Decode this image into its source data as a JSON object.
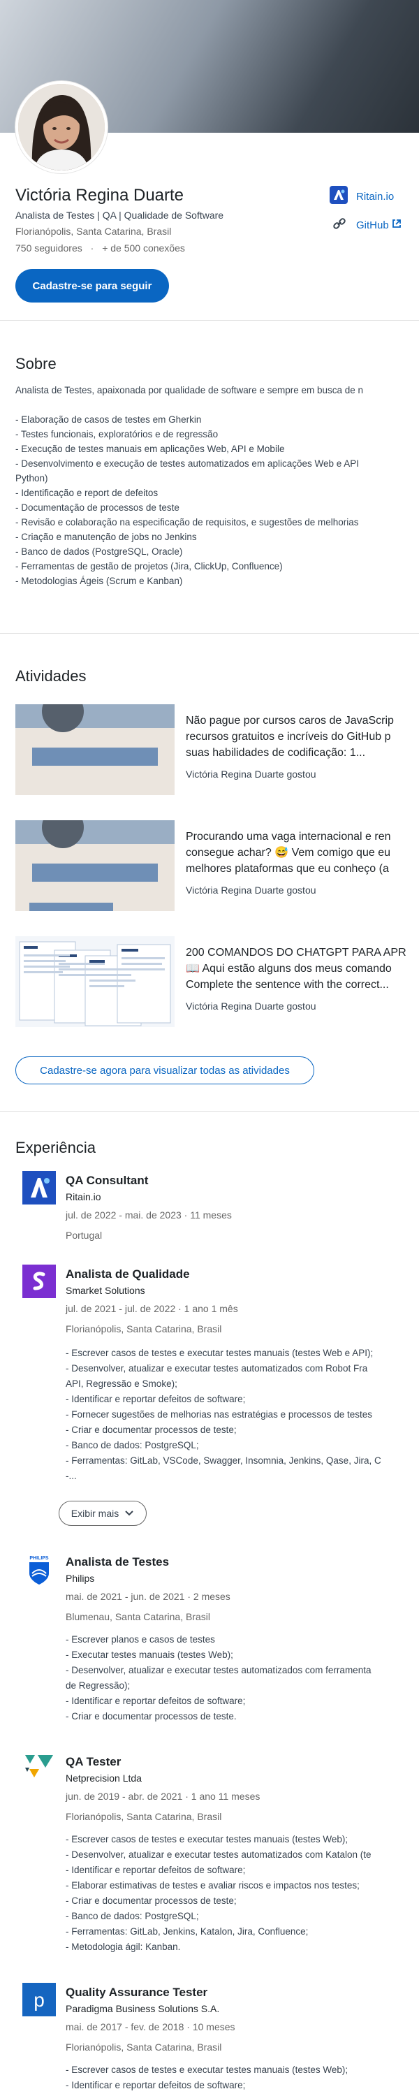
{
  "profile": {
    "name": "Victória Regina Duarte",
    "headline": "Analista de Testes | QA | Qualidade de Software",
    "location": "Florianópolis, Santa Catarina, Brasil",
    "followers": "750 seguidores",
    "separator": "·",
    "connections": "+ de 500 conexões",
    "follow_button": "Cadastre-se para seguir",
    "links": [
      {
        "label": "Ritain.io",
        "icon": "ritain-logo-icon"
      },
      {
        "label": "GitHub",
        "icon": "link-icon",
        "external_icon": "external-link-icon"
      }
    ]
  },
  "about": {
    "title": "Sobre",
    "text": "Analista de Testes, apaixonada por qualidade de software e sempre em busca de n\n\n- Elaboração de casos de testes em Gherkin\n- Testes funcionais, exploratórios e de regressão\n- Execução de testes manuais em aplicações Web, API e Mobile\n- Desenvolvimento e execução de testes automatizados em aplicações Web e API\nPython)\n- Identificação e report de defeitos\n- Documentação de processos de teste\n- Revisão e colaboração na especificação de requisitos, e sugestões de melhorias\n- Criação e manutenção de jobs no Jenkins\n- Banco de dados (PostgreSQL, Oracle)\n- Ferramentas de gestão de projetos (Jira, ClickUp, Confluence)\n- Metodologias Ágeis (Scrum e Kanban)"
  },
  "activities": {
    "title": "Atividades",
    "items": [
      {
        "title": "Não pague por cursos caros de JavaScrip\nrecursos gratuitos e incríveis do GitHub p\nsuas habilidades de codificação: 1...",
        "liked": "Victória Regina Duarte gostou"
      },
      {
        "title": "Procurando uma vaga internacional e ren\nconsegue achar? 😅 Vem comigo que eu\nmelhores plataformas que eu conheço (a",
        "liked": "Victória Regina Duarte gostou"
      },
      {
        "title": "200 COMANDOS DO CHATGPT PARA APR\n📖 Aqui estão alguns dos meus comando\nComplete the sentence with the correct...",
        "liked": "Victória Regina Duarte gostou"
      }
    ],
    "button": "Cadastre-se agora para visualizar todas as atividades"
  },
  "experience": {
    "title": "Experiência",
    "show_more": "Exibir mais",
    "items": [
      {
        "role": "QA Consultant",
        "company": "Ritain.io",
        "dates": "jul. de 2022 - mai. de 2023 · 11 meses",
        "location": "Portugal",
        "description": "",
        "color": "#1e4fbf"
      },
      {
        "role": "Analista de Qualidade",
        "company": "Smarket Solutions",
        "dates": "jul. de 2021 - jul. de 2022 · 1 ano 1 mês",
        "location": "Florianópolis, Santa Catarina, Brasil",
        "description": "- Escrever casos de testes e executar testes manuais (testes Web e API);\n- Desenvolver, atualizar e executar testes automatizados com Robot Fra\nAPI, Regressão e Smoke);\n- Identificar e reportar defeitos de software;\n- Fornecer sugestões de melhorias nas estratégias e processos de testes\n- Criar e documentar processos de teste;\n- Banco de dados: PostgreSQL;\n- Ferramentas: GitLab, VSCode, Swagger, Insomnia, Jenkins, Qase, Jira, C\n-...",
        "color": "#7b2fd1"
      },
      {
        "role": "Analista de Testes",
        "company": "Philips",
        "dates": "mai. de 2021 - jun. de 2021 · 2 meses",
        "location": "Blumenau, Santa Catarina, Brasil",
        "description": "- Escrever planos e casos de testes\n- Executar testes manuais (testes Web);\n- Desenvolver, atualizar e executar testes automatizados com ferramenta\nde Regressão);\n- Identificar e reportar defeitos de software;\n- Criar e documentar processos de teste.",
        "color": "#0b5ed7"
      },
      {
        "role": "QA Tester",
        "company": "Netprecision Ltda",
        "dates": "jun. de 2019 - abr. de 2021 · 1 ano 11 meses",
        "location": "Florianópolis, Santa Catarina, Brasil",
        "description": "- Escrever casos de testes e executar testes manuais (testes Web);\n- Desenvolver, atualizar e executar testes automatizados com Katalon (te\n- Identificar e reportar defeitos de software;\n- Elaborar estimativas de testes e avaliar riscos e impactos nos testes;\n- Criar e documentar processos de teste;\n- Banco de dados: PostgreSQL;\n- Ferramentas: GitLab, Jenkins, Katalon, Jira, Confluence;\n- Metodologia ágil: Kanban.",
        "color": "#2a9d8f"
      },
      {
        "role": "Quality Assurance Tester",
        "company": "Paradigma Business Solutions S.A.",
        "dates": "mai. de 2017 - fev. de 2018 · 10 meses",
        "location": "Florianópolis, Santa Catarina, Brasil",
        "description": "- Escrever casos de testes e executar testes manuais (testes Web);\n- Identificar e reportar defeitos de software;",
        "color": "#1565c0"
      }
    ]
  }
}
